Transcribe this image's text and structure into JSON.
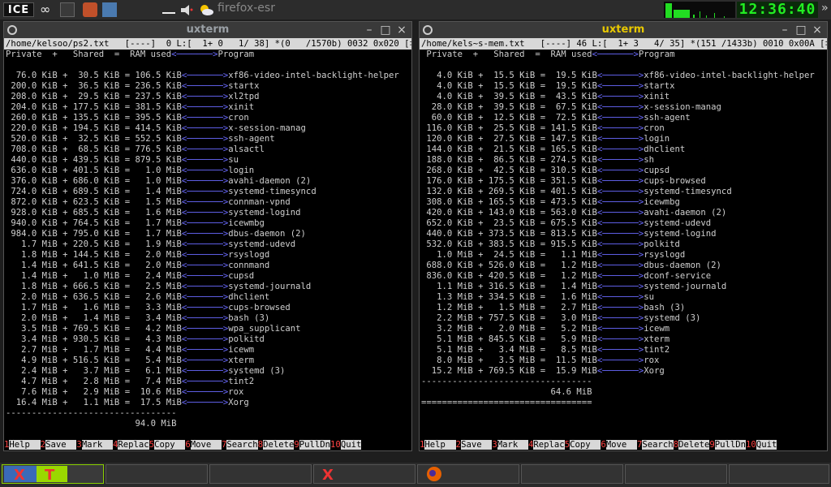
{
  "panel": {
    "logo": "ICE",
    "active_title": "firefox-esr",
    "clock": "12:36:40",
    "overflow": "»"
  },
  "left": {
    "title": "uxterm",
    "status": "/home/kelsoo/ps2.txt   [----]  0 L:[  1+ 0   1/ 38] *(0   /1570b) 0032 0x020 [‡][X]",
    "header": "Private  +   Shared  =  RAM used",
    "header_prog": "Program",
    "rows": [
      [
        "  76.0 KiB +  30.5 KiB = 106.5 KiB",
        "xf86-video-intel-backlight-helper"
      ],
      [
        " 200.0 KiB +  36.5 KiB = 236.5 KiB",
        "startx"
      ],
      [
        " 208.0 KiB +  29.5 KiB = 237.5 KiB",
        "xl2tpd"
      ],
      [
        " 204.0 KiB + 177.5 KiB = 381.5 KiB",
        "xinit"
      ],
      [
        " 260.0 KiB + 135.5 KiB = 395.5 KiB",
        "cron"
      ],
      [
        " 220.0 KiB + 194.5 KiB = 414.5 KiB",
        "x-session-manag"
      ],
      [
        " 520.0 KiB +  32.5 KiB = 552.5 KiB",
        "ssh-agent"
      ],
      [
        " 708.0 KiB +  68.5 KiB = 776.5 KiB",
        "alsactl"
      ],
      [
        " 440.0 KiB + 439.5 KiB = 879.5 KiB",
        "su"
      ],
      [
        " 636.0 KiB + 401.5 KiB =   1.0 MiB",
        "login"
      ],
      [
        " 376.0 KiB + 686.0 KiB =   1.0 MiB",
        "avahi-daemon (2)"
      ],
      [
        " 724.0 KiB + 689.5 KiB =   1.4 MiB",
        "systemd-timesyncd"
      ],
      [
        " 872.0 KiB + 623.5 KiB =   1.5 MiB",
        "connman-vpnd"
      ],
      [
        " 928.0 KiB + 685.5 KiB =   1.6 MiB",
        "systemd-logind"
      ],
      [
        " 940.0 KiB + 764.5 KiB =   1.7 MiB",
        "icewmbg"
      ],
      [
        " 984.0 KiB + 795.0 KiB =   1.7 MiB",
        "dbus-daemon (2)"
      ],
      [
        "   1.7 MiB + 220.5 KiB =   1.9 MiB",
        "systemd-udevd"
      ],
      [
        "   1.8 MiB + 144.5 KiB =   2.0 MiB",
        "rsyslogd"
      ],
      [
        "   1.4 MiB + 641.5 KiB =   2.0 MiB",
        "connmand"
      ],
      [
        "   1.4 MiB +   1.0 MiB =   2.4 MiB",
        "cupsd"
      ],
      [
        "   1.8 MiB + 666.5 KiB =   2.5 MiB",
        "systemd-journald"
      ],
      [
        "   2.0 MiB + 636.5 KiB =   2.6 MiB",
        "dhclient"
      ],
      [
        "   1.7 MiB +   1.6 MiB =   3.3 MiB",
        "cups-browsed"
      ],
      [
        "   2.0 MiB +   1.4 MiB =   3.4 MiB",
        "bash (3)"
      ],
      [
        "   3.5 MiB + 769.5 KiB =   4.2 MiB",
        "wpa_supplicant"
      ],
      [
        "   3.4 MiB + 930.5 KiB =   4.3 MiB",
        "polkitd"
      ],
      [
        "   2.7 MiB +   1.7 MiB =   4.4 MiB",
        "icewm"
      ],
      [
        "   4.9 MiB + 516.5 KiB =   5.4 MiB",
        "xterm"
      ],
      [
        "   2.4 MiB +   3.7 MiB =   6.1 MiB",
        "systemd (3)"
      ],
      [
        "   4.7 MiB +   2.8 MiB =   7.4 MiB",
        "tint2"
      ],
      [
        "   7.6 MiB +   2.9 MiB =  10.6 MiB",
        "rox"
      ],
      [
        "  16.4 MiB +   1.1 MiB =  17.5 MiB",
        "Xorg"
      ]
    ],
    "sep1": "---------------------------------",
    "total": "                         94.0 MiB",
    "sep2": "================================="
  },
  "right": {
    "title": "uxterm",
    "status": "/home/kels~s-mem.txt   [----] 46 L:[  1+ 3   4/ 35] *(151 /1433b) 0010 0x00A [‡][X]",
    "header": " Private  +   Shared  =  RAM used",
    "header_prog": "Program",
    "rows": [
      [
        "   4.0 KiB +  15.5 KiB =  19.5 KiB",
        "xf86-video-intel-backlight-helper"
      ],
      [
        "   4.0 KiB +  15.5 KiB =  19.5 KiB",
        "startx"
      ],
      [
        "   4.0 KiB +  39.5 KiB =  43.5 KiB",
        "xinit"
      ],
      [
        "  28.0 KiB +  39.5 KiB =  67.5 KiB",
        "x-session-manag"
      ],
      [
        "  60.0 KiB +  12.5 KiB =  72.5 KiB",
        "ssh-agent"
      ],
      [
        " 116.0 KiB +  25.5 KiB = 141.5 KiB",
        "cron"
      ],
      [
        " 120.0 KiB +  27.5 KiB = 147.5 KiB",
        "login"
      ],
      [
        " 144.0 KiB +  21.5 KiB = 165.5 KiB",
        "dhclient"
      ],
      [
        " 188.0 KiB +  86.5 KiB = 274.5 KiB",
        "sh"
      ],
      [
        " 268.0 KiB +  42.5 KiB = 310.5 KiB",
        "cupsd"
      ],
      [
        " 176.0 KiB + 175.5 KiB = 351.5 KiB",
        "cups-browsed"
      ],
      [
        " 132.0 KiB + 269.5 KiB = 401.5 KiB",
        "systemd-timesyncd"
      ],
      [
        " 308.0 KiB + 165.5 KiB = 473.5 KiB",
        "icewmbg"
      ],
      [
        " 420.0 KiB + 143.0 KiB = 563.0 KiB",
        "avahi-daemon (2)"
      ],
      [
        " 652.0 KiB +  23.5 KiB = 675.5 KiB",
        "systemd-udevd"
      ],
      [
        " 440.0 KiB + 373.5 KiB = 813.5 KiB",
        "systemd-logind"
      ],
      [
        " 532.0 KiB + 383.5 KiB = 915.5 KiB",
        "polkitd"
      ],
      [
        "   1.0 MiB +  24.5 KiB =   1.1 MiB",
        "rsyslogd"
      ],
      [
        " 688.0 KiB + 526.0 KiB =   1.2 MiB",
        "dbus-daemon (2)"
      ],
      [
        " 836.0 KiB + 420.5 KiB =   1.2 MiB",
        "dconf-service"
      ],
      [
        "   1.1 MiB + 316.5 KiB =   1.4 MiB",
        "systemd-journald"
      ],
      [
        "   1.3 MiB + 334.5 KiB =   1.6 MiB",
        "su"
      ],
      [
        "   1.2 MiB +   1.5 MiB =   2.7 MiB",
        "bash (3)"
      ],
      [
        "   2.2 MiB + 757.5 KiB =   3.0 MiB",
        "systemd (3)"
      ],
      [
        "   3.2 MiB +   2.0 MiB =   5.2 MiB",
        "icewm"
      ],
      [
        "   5.1 MiB + 845.5 KiB =   5.9 MiB",
        "xterm"
      ],
      [
        "   5.1 MiB +   3.4 MiB =   8.5 MiB",
        "tint2"
      ],
      [
        "   8.0 MiB +   3.5 MiB =  11.5 MiB",
        "rox"
      ],
      [
        "  15.2 MiB + 769.5 KiB =  15.9 MiB",
        "Xorg"
      ]
    ],
    "sep1": "---------------------------------",
    "total": "                         64.6 MiB",
    "sep2": "================================="
  },
  "fkeys": [
    {
      "n": "1",
      "l": "Help  "
    },
    {
      "n": "2",
      "l": "Save  "
    },
    {
      "n": "3",
      "l": "Mark  "
    },
    {
      "n": "4",
      "l": "Replac"
    },
    {
      "n": "5",
      "l": "Copy  "
    },
    {
      "n": "6",
      "l": "Move  "
    },
    {
      "n": "7",
      "l": "Search"
    },
    {
      "n": "8",
      "l": "Delete"
    },
    {
      "n": "9",
      "l": "PullDn"
    },
    {
      "n": "10",
      "l": "Quit"
    }
  ],
  "controls": {
    "minimize": "–",
    "maximize": "□",
    "close": "×"
  },
  "colors": {
    "title_active": "#e8c800",
    "title_inactive": "#9aa0a6",
    "arrow": "#6a6aff",
    "clock": "#22ee22",
    "fkey_num": "#ff4444"
  },
  "icons": {
    "apps": "ice-menu-icon",
    "overview": "infinity-icon",
    "terminal": "terminal-icon",
    "firefox": "firefox-icon",
    "xterm": "x-icon",
    "weather": "sun-cloud-icon"
  }
}
